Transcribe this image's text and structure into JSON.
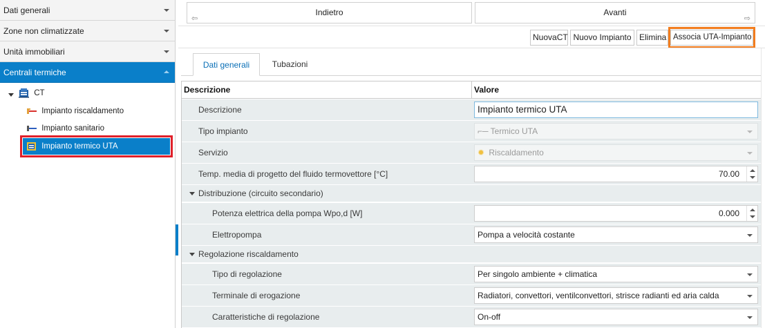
{
  "sidebar": {
    "sections": [
      {
        "label": "Dati generali"
      },
      {
        "label": "Zone non climatizzate"
      },
      {
        "label": "Unità immobiliari"
      },
      {
        "label": "Centrali termiche"
      }
    ],
    "tree": {
      "root": "CT",
      "children": [
        {
          "label": "Impianto riscaldamento",
          "icon": "heating-plant-icon"
        },
        {
          "label": "Impianto sanitario",
          "icon": "sanitary-plant-icon"
        },
        {
          "label": "Impianto termico UTA",
          "icon": "uta-plant-icon"
        }
      ]
    }
  },
  "nav": {
    "back": "Indietro",
    "forward": "Avanti"
  },
  "toolbar": {
    "new_ct": "NuovaCT",
    "new_plant": "Nuovo Impianto",
    "delete": "Elimina",
    "associate": "Associa UTA-Impianto"
  },
  "tabs": {
    "general": "Dati generali",
    "pipes": "Tubazioni"
  },
  "grid": {
    "header_desc": "Descrizione",
    "header_value": "Valore",
    "rows": {
      "descr": {
        "label": "Descrizione",
        "value": "Impianto termico UTA"
      },
      "type": {
        "label": "Tipo impianto",
        "value": "Termico UTA"
      },
      "service": {
        "label": "Servizio",
        "value": "Riscaldamento"
      },
      "temp": {
        "label": "Temp. media di progetto del fluido termovettore [°C]",
        "value": "70.00"
      },
      "dist_section": "Distribuzione (circuito secondario)",
      "pump_power": {
        "label": "Potenza elettrica della pompa Wpo,d [W]",
        "value": "0.000"
      },
      "pump": {
        "label": "Elettropompa",
        "value": "Pompa a velocità costante"
      },
      "reg_section": "Regolazione riscaldamento",
      "reg_type": {
        "label": "Tipo di regolazione",
        "value": "Per singolo ambiente + climatica"
      },
      "terminal": {
        "label": "Terminale di erogazione",
        "value": "Radiatori, convettori, ventilconvettori, strisce radianti ed aria calda"
      },
      "reg_char": {
        "label": "Caratteristiche di regolazione",
        "value": "On-off"
      }
    }
  },
  "colors": {
    "accent": "#0a7fc9",
    "selection_highlight": "#e0202a",
    "button_highlight": "#f27d1e",
    "grid_row": "#e8edee"
  }
}
